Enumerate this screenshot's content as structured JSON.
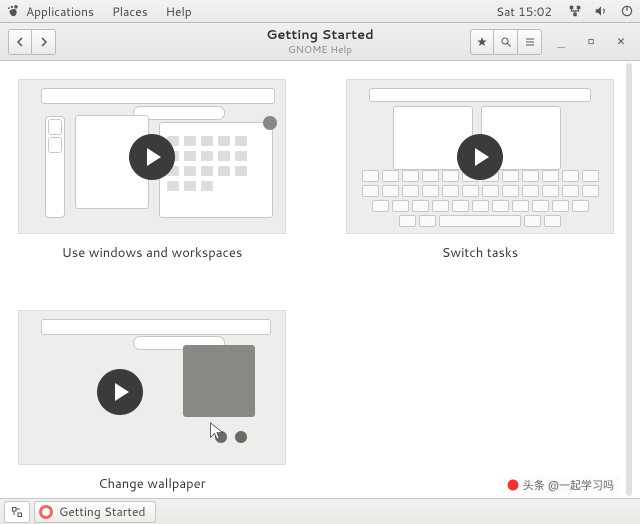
{
  "panel": {
    "applications": "Applications",
    "places": "Places",
    "help": "Help",
    "clock": "Sat 15:02"
  },
  "headerbar": {
    "title": "Getting Started",
    "subtitle": "GNOME Help"
  },
  "tiles": [
    {
      "caption": "Use windows and workspaces"
    },
    {
      "caption": "Switch tasks"
    },
    {
      "caption": "Change wallpaper"
    }
  ],
  "taskbar": {
    "item_label": "Getting Started"
  },
  "watermark": {
    "text": "头条 @一起学习吗"
  }
}
